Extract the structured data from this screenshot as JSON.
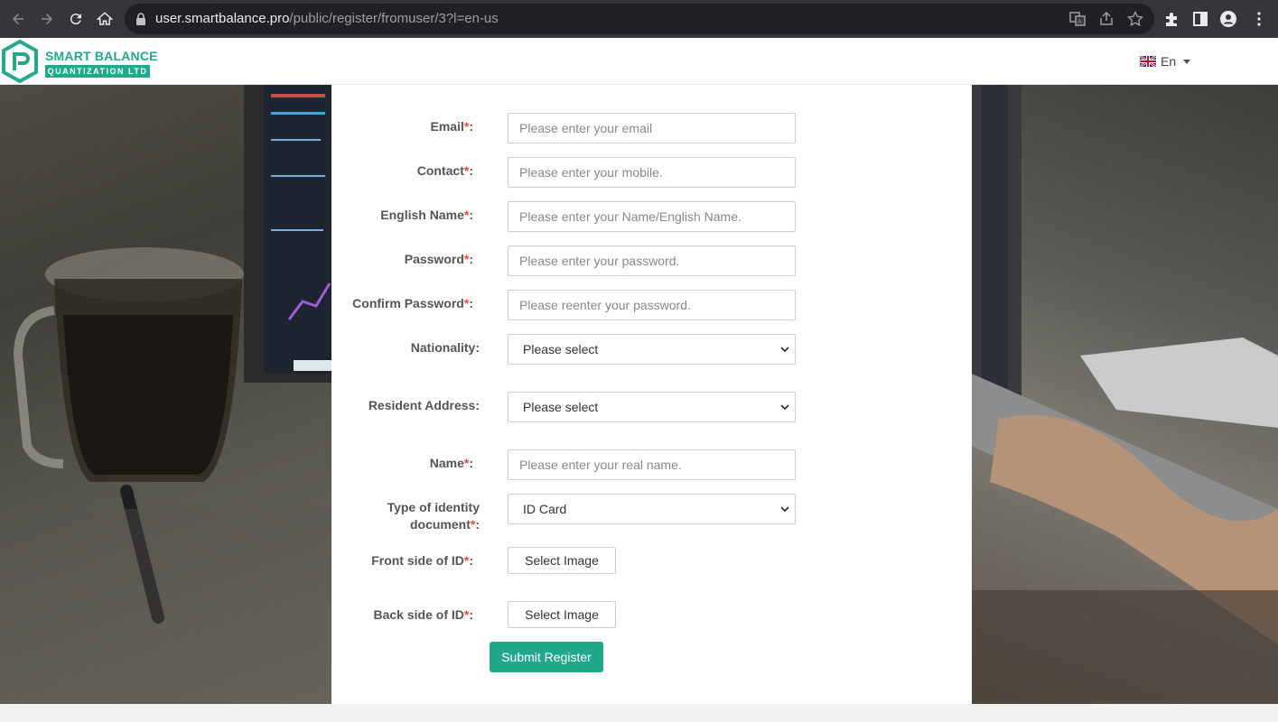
{
  "browser": {
    "url_host": "user.smartbalance.pro",
    "url_path": "/public/register/fromuser/3?l=en-us",
    "icons": [
      "back-icon",
      "forward-icon",
      "reload-icon",
      "home-icon",
      "lock-icon",
      "translate-icon",
      "share-icon",
      "star-icon",
      "extensions-icon",
      "sidepanel-icon",
      "profile-icon",
      "menu-icon"
    ]
  },
  "header": {
    "brand_title": "SMART BALANCE",
    "brand_subtitle": "QUANTIZATION LTD",
    "language": "En",
    "brand_color": "#22a98a"
  },
  "form": {
    "email": {
      "label": "Email",
      "placeholder": "Please enter your email"
    },
    "contact": {
      "label": "Contact",
      "placeholder": "Please enter your mobile."
    },
    "english_name": {
      "label": "English Name",
      "placeholder": "Please enter your Name/English Name."
    },
    "password": {
      "label": "Password",
      "placeholder": "Please enter your password."
    },
    "confirm_password": {
      "label": "Confirm Password",
      "placeholder": "Please reenter your password."
    },
    "nationality": {
      "label": "Nationality:",
      "value": "Please select"
    },
    "resident_address": {
      "label": "Resident Address:",
      "value": "Please select"
    },
    "name": {
      "label": "Name",
      "placeholder": "Please enter your real name."
    },
    "id_type": {
      "label": "Type of identity document",
      "value": "ID Card"
    },
    "front_id": {
      "label": "Front side of ID",
      "button": "Select Image"
    },
    "back_id": {
      "label": "Back side of ID",
      "button": "Select Image"
    },
    "required_mark": "*",
    "colon": ":",
    "submit": "Submit Register"
  }
}
